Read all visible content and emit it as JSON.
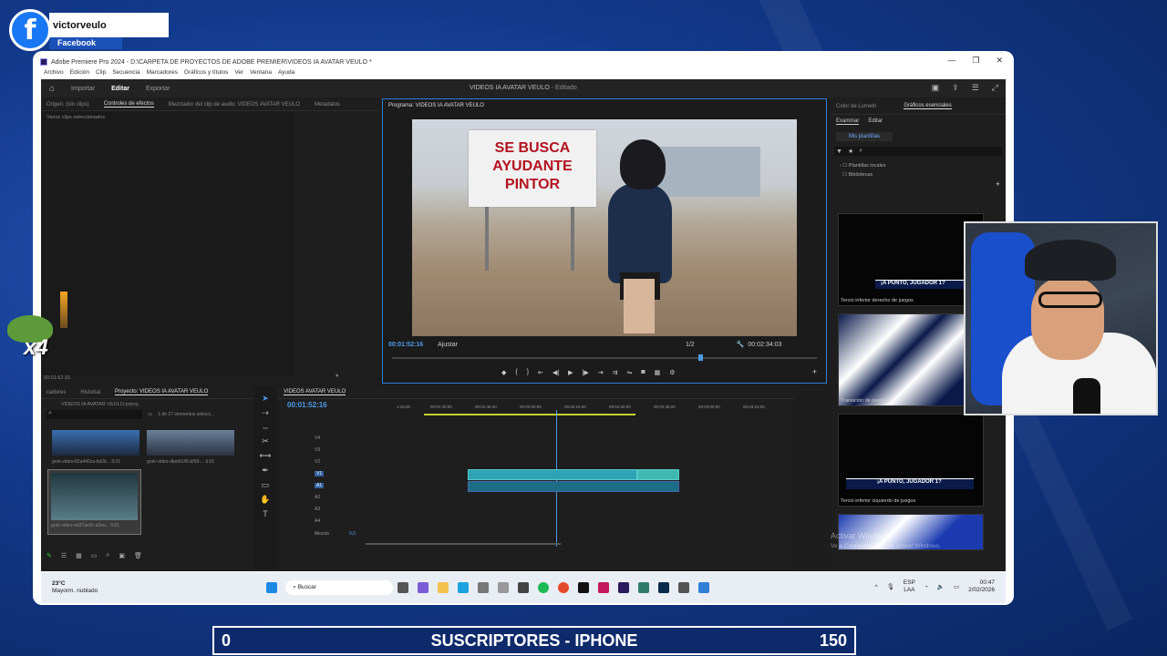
{
  "overlay": {
    "fb_icon": "f",
    "fb_name": "victorveulo",
    "fb_sub": "Facebook",
    "multiplier": "x4"
  },
  "window": {
    "title": "Adobe Premiere Pro 2024 - D:\\CARPETA DE PROYECTOS DE ADOBE PREMIER\\VIDEOS IA AVATAR VEULO *",
    "menu": [
      "Archivo",
      "Edición",
      "Clip",
      "Secuencia",
      "Marcadores",
      "Gráficos y títulos",
      "Ver",
      "Ventana",
      "Ayuda"
    ]
  },
  "topbar": {
    "tabs": [
      "Importar",
      "Editar",
      "Exportar"
    ],
    "project_name": "VIDEOS IA AVATAR VEULO",
    "status": "Editado"
  },
  "effects_panel": {
    "tabs": [
      "Origen: (sin clips)",
      "Controles de efectos",
      "Mezclador del clip de audio: VIDEOS AVATAR VEULO",
      "Metadatos"
    ],
    "message": "Varios clips seleccionados",
    "timecode": "00:01:52:16"
  },
  "program_monitor": {
    "title": "Programa: VIDEOS IA AVATAR VEULO",
    "sign_text": [
      "SE BUSCA",
      "AYUDANTE",
      "PINTOR"
    ],
    "current_time": "00:01:52:16",
    "fit": "Ajustar",
    "resolution": "1/2",
    "duration": "00:02:34:03"
  },
  "right_panel": {
    "tabs": [
      "Color de Lumetri",
      "Gráficos esenciales"
    ],
    "sub_tabs": [
      "Examinar",
      "Editar"
    ],
    "my_templates": "Mis plantillas",
    "tree": [
      "Plantillas locales",
      "Bibliotecas"
    ],
    "templates": [
      {
        "label": "Tercio inferior derecho de juegos",
        "banner": "¡A PUNTO, JUGADOR 1?"
      },
      {
        "label": "Transición de juegos",
        "banner": ""
      },
      {
        "label": "Tercio inferior izquierdo de juegos",
        "banner": "¡A PUNTO, JUGADOR 1?"
      }
    ],
    "watermark_title": "Activar Windows",
    "watermark_sub": "Ve a Configuración para activar Windows."
  },
  "project_panel": {
    "tabs": [
      "cadores",
      "Historial",
      "Proyecto: VIDEOS IA AVATAR VEULO"
    ],
    "file": "VIDEOS IA AVATAR VEULO.prproj",
    "count": "1 de 27 elementos selecci...",
    "items": [
      {
        "name": "grok-video-82a440ca-bd2b...",
        "dur": "6:01"
      },
      {
        "name": "grok-video-dbebf145-bf99-...",
        "dur": "6:01"
      },
      {
        "name": "grok-video-ed37ae0c-a3ee...",
        "dur": "6:01"
      }
    ]
  },
  "timeline": {
    "title": "VIDEOS AVATAR VEULO",
    "timecode": "00:01:52:16",
    "ruler": [
      "1:15:00",
      "00:01:30:00",
      "00:01:45:00",
      "00:02:00:00",
      "00:02:15:00",
      "00:02:30:00",
      "00:02:45:00",
      "00:03:00:00",
      "00:03:15:00"
    ],
    "tracks": [
      "V4",
      "V3",
      "V2",
      "V1",
      "A1",
      "A2",
      "A3",
      "A4"
    ],
    "mix_label": "Mezcla",
    "mix_value": "0,0"
  },
  "taskbar": {
    "weather_temp": "23°C",
    "weather_desc": "Mayorm. nublado",
    "search": "Buscar",
    "lang": "ESP",
    "lang2": "LAA",
    "time": "00:47",
    "date": "2/02/2026"
  },
  "subs_bar": {
    "left": "0",
    "title": "SUSCRIPTORES - IPHONE",
    "right": "150"
  }
}
